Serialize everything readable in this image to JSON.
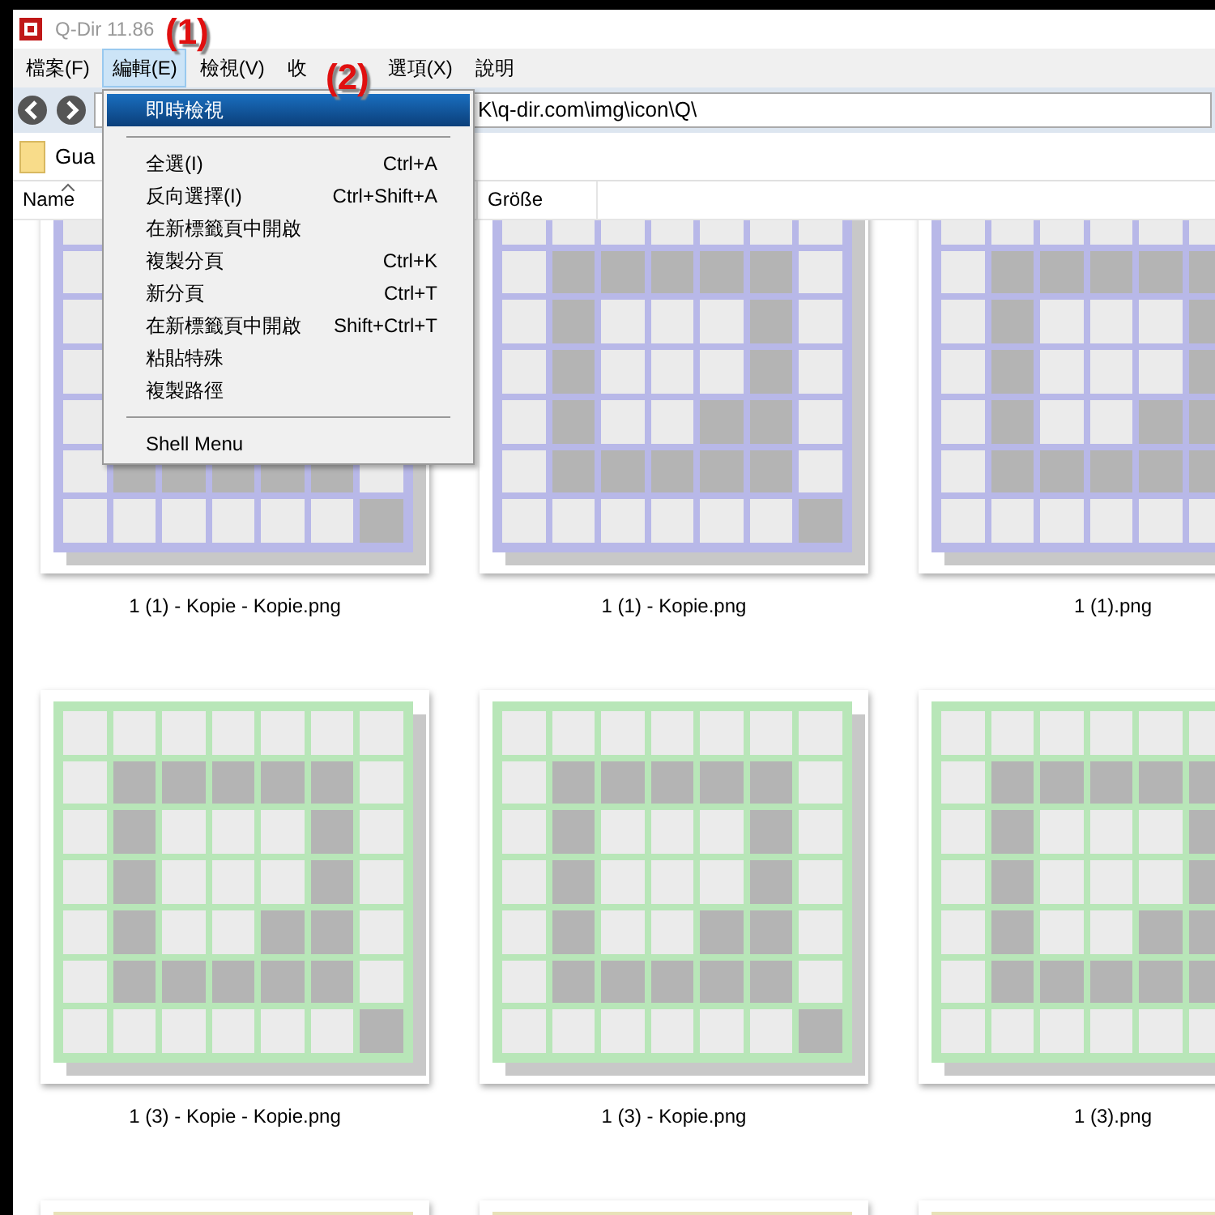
{
  "window": {
    "title": "Q-Dir 11.86"
  },
  "annotations": [
    {
      "label": "(1)",
      "kind": "first"
    },
    {
      "label": "(2)",
      "kind": "second"
    }
  ],
  "menu_bar": [
    {
      "label": "檔案(F)",
      "selected": false
    },
    {
      "label": "編輯(E)",
      "selected": true
    },
    {
      "label": "檢視(V)",
      "selected": false
    },
    {
      "label": "收",
      "selected": false
    },
    {
      "label": "選項(X)",
      "selected": false
    },
    {
      "label": "說明",
      "selected": false
    }
  ],
  "address_bar": {
    "value": "K\\q-dir.com\\img\\icon\\Q\\"
  },
  "breadcrumb": {
    "label": "Gua"
  },
  "columns": [
    {
      "label": "Name",
      "sorted": true
    },
    {
      "label": "Größe",
      "sorted": false
    }
  ],
  "edit_menu": [
    {
      "kind": "item",
      "label": "即時檢視",
      "selected": true
    },
    {
      "kind": "separator"
    },
    {
      "kind": "item",
      "label": "全選(I)",
      "shortcut": "Ctrl+A",
      "selected": false
    },
    {
      "kind": "item",
      "label": "反向選擇(I)",
      "shortcut": "Ctrl+Shift+A",
      "selected": false
    },
    {
      "kind": "item",
      "label": "在新標籤頁中開啟",
      "selected": false
    },
    {
      "kind": "item",
      "label": "複製分頁",
      "shortcut": "Ctrl+K",
      "selected": false
    },
    {
      "kind": "item",
      "label": "新分頁",
      "shortcut": "Ctrl+T",
      "selected": false
    },
    {
      "kind": "item",
      "label": "在新標籤頁中開啟",
      "shortcut": "Shift+Ctrl+T",
      "selected": false
    },
    {
      "kind": "item",
      "label": "粘貼特殊",
      "selected": false
    },
    {
      "kind": "item",
      "label": "複製路徑",
      "selected": false
    },
    {
      "kind": "separator"
    },
    {
      "kind": "item",
      "label": "Shell Menu",
      "selected": false
    }
  ],
  "thumbnails": [
    {
      "name": "1 (1) - Kopie - Kopie.png",
      "color": "#b8b8e8"
    },
    {
      "name": "1 (1) - Kopie.png",
      "color": "#b8b8e8"
    },
    {
      "name": "1 (1).png",
      "color": "#b8b8e8"
    },
    {
      "name": "1 (3) - Kopie - Kopie.png",
      "color": "#b8e6b8"
    },
    {
      "name": "1 (3) - Kopie.png",
      "color": "#b8e6b8"
    },
    {
      "name": "1 (3).png",
      "color": "#b8e6b8"
    },
    {
      "color": "#e8e2b8"
    },
    {
      "color": "#e8e2b8"
    },
    {
      "color": "#e8e2b8"
    }
  ]
}
